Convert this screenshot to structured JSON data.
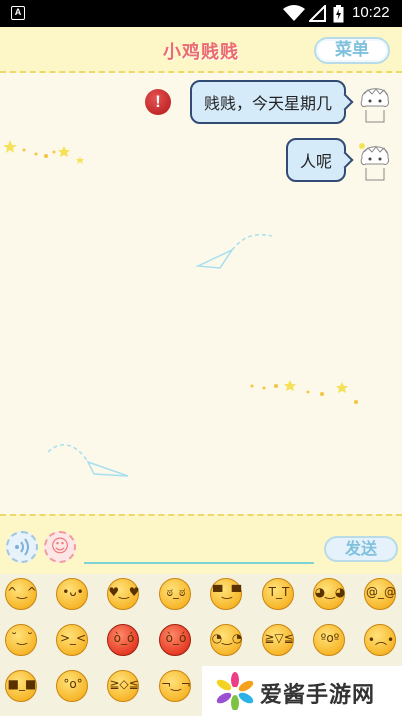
{
  "status_bar": {
    "time": "10:22",
    "notification_icon": "A"
  },
  "header": {
    "title": "小鸡贱贱",
    "menu_label": "菜单"
  },
  "messages": [
    {
      "text": "贱贱，今天星期几",
      "failed": true
    },
    {
      "text": "人呢",
      "failed": false
    }
  ],
  "error_icon_glyph": "!",
  "input": {
    "value": "",
    "placeholder": "",
    "send_label": "发送"
  },
  "emoji_faces": [
    "^‿^",
    "•ᴗ•",
    "♥‿♥",
    "ಠ_ಠ",
    "▀̿‿▀",
    "T_T",
    "◕‿◕",
    "@_@",
    "˘‿˘",
    ">_<",
    "ò_ó",
    "ò_ó",
    "◔‿◔",
    "≧▽≦",
    "ºoº",
    "•︵•",
    "■_■",
    "°o°",
    "≧◇≦",
    "¬‿¬"
  ],
  "watermark": {
    "text": "爱酱手游网"
  },
  "colors": {
    "bubble": "#d6ebfa",
    "header": "#fdf6c6",
    "title": "#ec6b6b"
  }
}
